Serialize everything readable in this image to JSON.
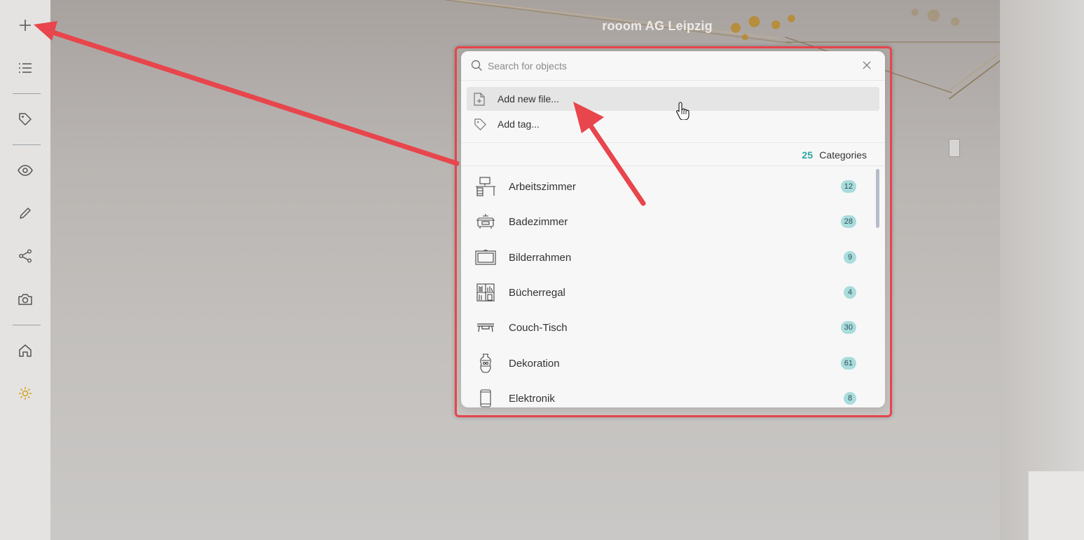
{
  "scene": {
    "title": "rooom AG Leipzig"
  },
  "toolbar": {
    "items": [
      {
        "icon": "plus-icon",
        "name": "add-button"
      },
      {
        "icon": "list-icon",
        "name": "list-button"
      },
      {
        "icon": "tag-icon",
        "name": "tag-button"
      },
      {
        "icon": "eye-icon",
        "name": "view-button"
      },
      {
        "icon": "pencil-icon",
        "name": "edit-button"
      },
      {
        "icon": "share-icon",
        "name": "share-button"
      },
      {
        "icon": "camera-icon",
        "name": "camera-button"
      },
      {
        "icon": "home-icon",
        "name": "home-button"
      },
      {
        "icon": "sun-icon",
        "name": "theme-button"
      }
    ]
  },
  "dialog": {
    "search": {
      "placeholder": "Search for objects",
      "value": ""
    },
    "actions": [
      {
        "icon": "file-plus-icon",
        "label": "Add new file..."
      },
      {
        "icon": "tag-icon",
        "label": "Add tag..."
      }
    ],
    "categories_count": "25",
    "categories_label": "Categories",
    "categories": [
      {
        "icon": "desk-icon",
        "name": "Arbeitszimmer",
        "count": "12"
      },
      {
        "icon": "bathtub-icon",
        "name": "Badezimmer",
        "count": "28"
      },
      {
        "icon": "picture-frame-icon",
        "name": "Bilderrahmen",
        "count": "9"
      },
      {
        "icon": "bookshelf-icon",
        "name": "Bücherregal",
        "count": "4"
      },
      {
        "icon": "coffee-table-icon",
        "name": "Couch-Tisch",
        "count": "30"
      },
      {
        "icon": "vase-icon",
        "name": "Dekoration",
        "count": "61"
      },
      {
        "icon": "smartphone-icon",
        "name": "Elektronik",
        "count": "8"
      }
    ]
  },
  "colors": {
    "accent": "#2aa6a2",
    "badge": "#a9dcdc",
    "annotation": "#e8454c",
    "sun": "#d4a017"
  }
}
